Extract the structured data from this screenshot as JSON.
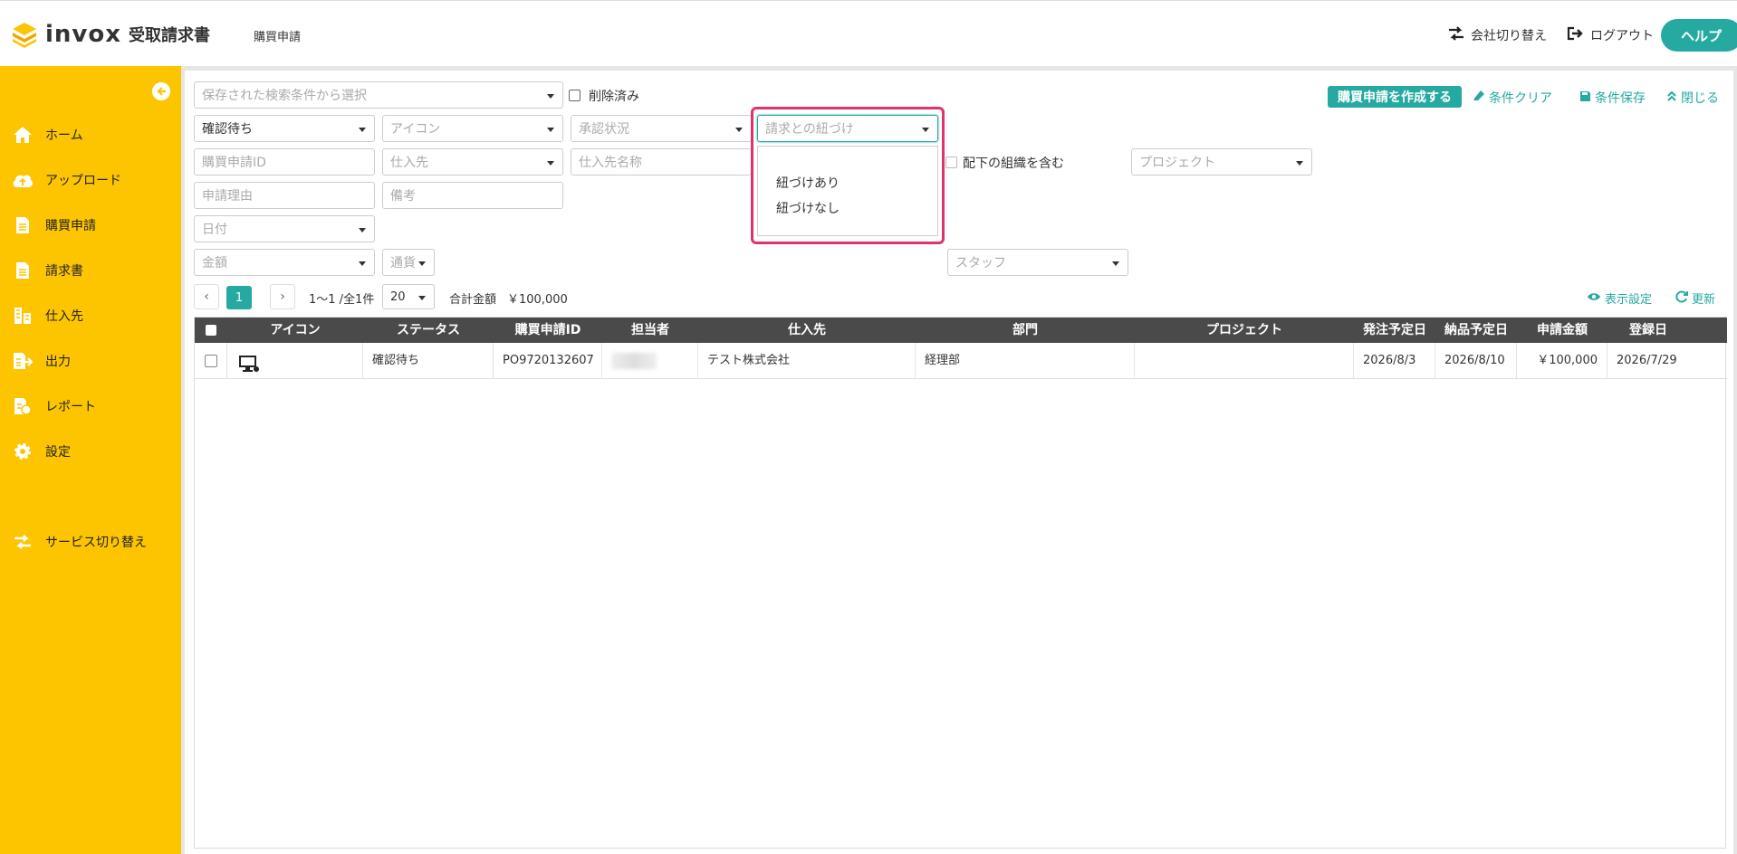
{
  "app": {
    "logo_text": "invox",
    "product": "受取請求書",
    "page_title": "購買申請"
  },
  "header": {
    "switch_company": "会社切り替え",
    "logout": "ログアウト",
    "help": "ヘルプ"
  },
  "sidebar": {
    "items": [
      {
        "label": "ホーム",
        "icon": "home-icon"
      },
      {
        "label": "アップロード",
        "icon": "cloud-upload-icon"
      },
      {
        "label": "購買申請",
        "icon": "document-icon"
      },
      {
        "label": "請求書",
        "icon": "document-icon"
      },
      {
        "label": "仕入先",
        "icon": "building-icon"
      },
      {
        "label": "出力",
        "icon": "export-icon"
      },
      {
        "label": "レポート",
        "icon": "report-icon"
      },
      {
        "label": "設定",
        "icon": "gear-icon"
      }
    ],
    "service_switch": "サービス切り替え"
  },
  "filters": {
    "saved_search_placeholder": "保存された検索条件から選択",
    "deleted_label": "削除済み",
    "status_value": "確認待ち",
    "icon_placeholder": "アイコン",
    "approval_placeholder": "承認状況",
    "invoice_link_placeholder": "請求との紐づけ",
    "purchase_id_placeholder": "購買申請ID",
    "supplier_placeholder": "仕入先",
    "supplier_name_placeholder": "仕入先名称",
    "include_sub_org_label": "配下の組織を含む",
    "project_placeholder": "プロジェクト",
    "reason_placeholder": "申請理由",
    "remarks_placeholder": "備考",
    "date_placeholder": "日付",
    "amount_placeholder": "金額",
    "currency_placeholder": "通貨",
    "staff_placeholder": "スタッフ"
  },
  "actions": {
    "create": "購買申請を作成する",
    "clear": "条件クリア",
    "save": "条件保存",
    "close": "閉じる",
    "display_settings": "表示設定",
    "refresh": "更新"
  },
  "dropdown": {
    "options": [
      "紐づけあり",
      "紐づけなし"
    ]
  },
  "pagination": {
    "current_page": "1",
    "range": "1〜1 /全1件",
    "per_page": "20",
    "total_label": "合計金額",
    "total_value": "￥100,000"
  },
  "table": {
    "headers": [
      "アイコン",
      "ステータス",
      "購買申請ID",
      "担当者",
      "仕入先",
      "部門",
      "プロジェクト",
      "発注予定日",
      "納品予定日",
      "申請金額",
      "登録日"
    ],
    "rows": [
      {
        "status": "確認待ち",
        "id": "PO9720132607",
        "assignee": "",
        "supplier": "テスト株式会社",
        "department": "経理部",
        "project": "",
        "order_date": "2026/8/3",
        "delivery_date": "2026/8/10",
        "amount": "￥100,000",
        "registered": "2026/7/29"
      }
    ]
  },
  "colors": {
    "accent": "#25a9a0",
    "sidebar": "#fcc500",
    "highlight": "#e0336e",
    "table_header": "#4a4a4a"
  }
}
